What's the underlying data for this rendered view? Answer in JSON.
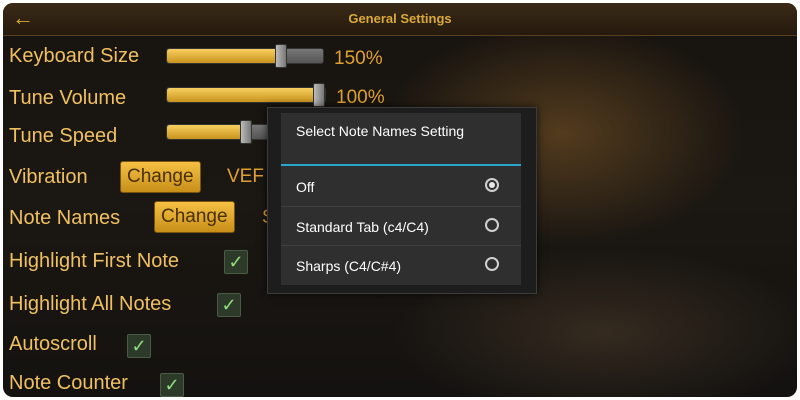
{
  "header": {
    "title": "General Settings",
    "back_icon": "arrow-left-icon"
  },
  "settings": {
    "keyboard_size": {
      "label": "Keyboard Size",
      "value": "150%",
      "level": 0.72
    },
    "tune_volume": {
      "label": "Tune Volume",
      "value": "100%",
      "level": 0.95
    },
    "tune_speed": {
      "label": "Tune Speed",
      "level": 0.5
    },
    "vibration": {
      "label": "Vibration",
      "button": "Change",
      "value_partial": "VEF"
    },
    "note_names": {
      "label": "Note Names",
      "button": "Change",
      "value_partial": "S"
    },
    "highlight_first": {
      "label": "Highlight First Note",
      "checked": true
    },
    "highlight_all": {
      "label": "Highlight All Notes",
      "checked": true
    },
    "autoscroll": {
      "label": "Autoscroll",
      "checked": true
    },
    "note_counter": {
      "label": "Note Counter",
      "checked": true
    }
  },
  "dialog": {
    "title": "Select Note Names Setting",
    "accent": "#2ba6cb",
    "options": [
      {
        "label": "Off",
        "selected": true
      },
      {
        "label": "Standard Tab (c4/C4)",
        "selected": false
      },
      {
        "label": "Sharps (C4/C#4)",
        "selected": false
      }
    ]
  },
  "colors": {
    "label_gold": "#f0c060",
    "check_green": "#8ee07a"
  }
}
